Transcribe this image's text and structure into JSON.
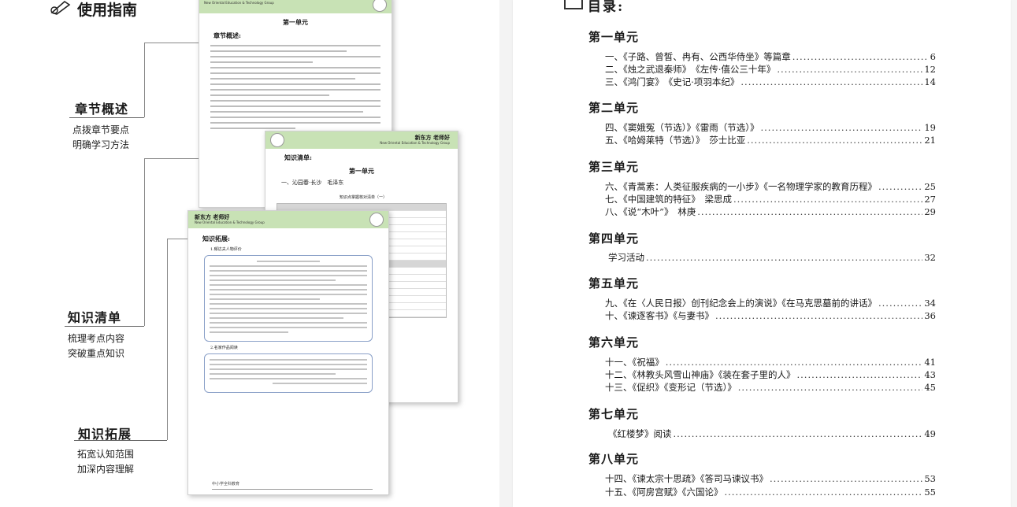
{
  "guide": {
    "title": "使用指南",
    "sections": [
      {
        "heading": "章节概述",
        "lines": [
          "点拨章节要点",
          "明确学习方法"
        ]
      },
      {
        "heading": "知识清单",
        "lines": [
          "梳理考点内容",
          "突破重点知识"
        ]
      },
      {
        "heading": "知识拓展",
        "lines": [
          "拓宽认知范围",
          "加深内容理解"
        ]
      }
    ]
  },
  "thumbs": {
    "brand": "新东方 老师好",
    "brand_sub": "New Oriental Education & Technology Group",
    "unit": "第一单元",
    "overview_label": "章节概述:",
    "list_label": "知识清单:",
    "list_item": "一、沁园春·长沙　毛泽东",
    "list_table_title": "知识点掌握核对清单（一）",
    "expand_label": "知识拓展:",
    "expand_item1": "1.郁达夫人物评价",
    "expand_item2": "2.名家作品阅读",
    "footer_brand": "中小学全科教育"
  },
  "toc": {
    "title": "目录:",
    "units": [
      {
        "name": "第一单元",
        "entries": [
          {
            "text": "一、《子路、曾皙、冉有、公西华侍坐》等篇章",
            "page": "6"
          },
          {
            "text": "二、《烛之武退秦师》　《左传·僖公三十年》",
            "page": "12"
          },
          {
            "text": "三、《鸿门宴》　《史记·项羽本纪》",
            "page": "14"
          }
        ]
      },
      {
        "name": "第二单元",
        "entries": [
          {
            "text": "四、《窦娥冤（节选）》《雷雨（节选）》",
            "page": "19"
          },
          {
            "text": "五、《哈姆莱特（节选）》　莎士比亚",
            "page": "21"
          }
        ]
      },
      {
        "name": "第三单元",
        "entries": [
          {
            "text": "六、《青蒿素：人类征服疾病的一小步》《一名物理学家的教育历程》",
            "page": "25"
          },
          {
            "text": "七、《中国建筑的特征》　梁思成",
            "page": "27"
          },
          {
            "text": "八、《说“木叶”》　林庚",
            "page": "29"
          }
        ]
      },
      {
        "name": "第四单元",
        "entries": [
          {
            "text": "学习活动",
            "page": "32"
          }
        ]
      },
      {
        "name": "第五单元",
        "entries": [
          {
            "text": "九、《在〈人民日报〉创刊纪念会上的演说》《在马克思墓前的讲话》",
            "page": "34"
          },
          {
            "text": "十、《谏逐客书》《与妻书》",
            "page": "36"
          }
        ]
      },
      {
        "name": "第六单元",
        "entries": [
          {
            "text": "十一、《祝福》",
            "page": "41"
          },
          {
            "text": "十二、《林教头风雪山神庙》《装在套子里的人》",
            "page": "43"
          },
          {
            "text": "十三、《促织》《变形记（节选）》",
            "page": "45"
          }
        ]
      },
      {
        "name": "第七单元",
        "entries": [
          {
            "text": "《红楼梦》阅读",
            "page": "49"
          }
        ]
      },
      {
        "name": "第八单元",
        "entries": [
          {
            "text": "十四、《谏太宗十思疏》《答司马谏议书》",
            "page": "53"
          },
          {
            "text": "十五、《阿房宫赋》《六国论》",
            "page": "55"
          }
        ]
      }
    ]
  }
}
